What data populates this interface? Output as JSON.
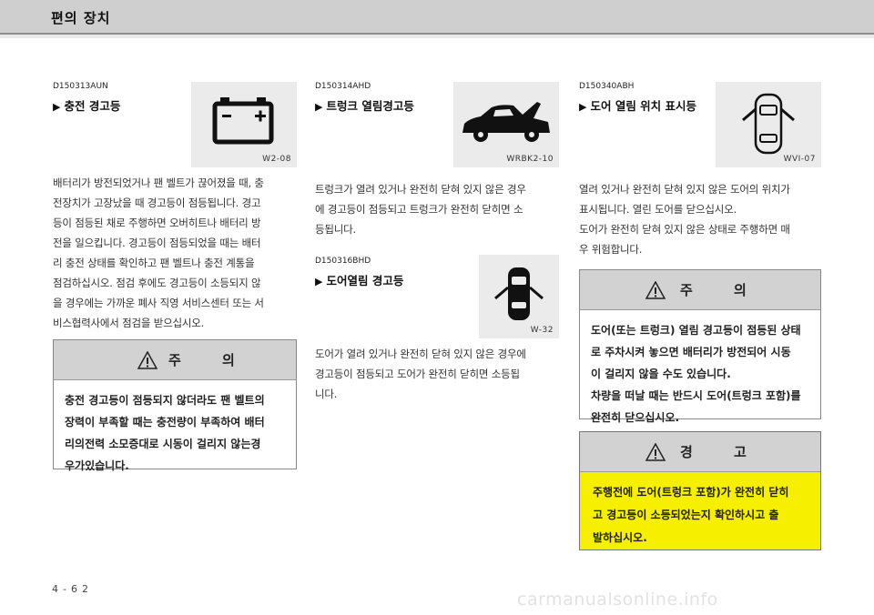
{
  "header": {
    "title": "편의 장치"
  },
  "col1": {
    "code": "D150313AUN",
    "heading": "충전 경고등",
    "icon_name": "battery-icon",
    "icon_code": "W2-08",
    "lines": [
      "배터리가 방전되었거나 팬 벨트가 끊어졌을 때, 충",
      "전장치가 고장났을 때 경고등이 점등됩니다. 경고",
      "등이 점등된 채로 주행하면 오버히트나 배터리 방",
      "전을 일으킵니다. 경고등이 점등되었을 때는 배터",
      "리 충전 상태를 확인하고 팬 벨트나 충전 계통을",
      "점검하십시오. 점검 후에도 경고등이 소등되지 않",
      "을 경우에는 가까운 폐사 직영 서비스센터 또는 서",
      "비스협력사에서 점검을 받으십시오."
    ],
    "caution": {
      "title": "주 의",
      "lines": [
        "충전 경고등이 점등되지 않더라도 팬 벨트의",
        "장력이 부족할 때는 충전량이 부족하여 배터",
        "리의전력 소모증대로 시동이 걸리지 않는경",
        "우가있습니다."
      ]
    }
  },
  "col2": {
    "code": "D150314AHD",
    "heading": "트렁크 열림경고등",
    "icon_name": "trunk-open-icon",
    "icon_code": "WRBK2-10",
    "lines": [
      "트렁크가 열려 있거나 완전히 닫혀 있지 않은 경우",
      "에 경고등이 점등되고 트렁크가 완전히 닫히면 소",
      "등됩니다."
    ],
    "code2": "D150316BHD",
    "heading2": "도어열림 경고등",
    "icon2_name": "door-open-icon",
    "icon2_code": "W-32",
    "lines2": [
      "도어가 열려 있거나 완전히 닫혀 있지 않은 경우에",
      "경고등이 점등되고 도어가 완전히 닫히면 소등됩",
      "니다."
    ]
  },
  "col3": {
    "code": "D150340ABH",
    "heading": "도어 열림 위치 표시등",
    "icon_name": "door-position-icon",
    "icon_code": "WVI-07",
    "lines": [
      "열려 있거나 완전히 닫혀 있지 않은 도어의 위치가",
      "표시됩니다. 열린 도어를 닫으십시오.",
      "도어가 완전히 닫혀 있지 않은 상태로 주행하면 매",
      "우 위험합니다."
    ],
    "caution": {
      "title": "주 의",
      "lines": [
        "도어(또는 트렁크) 열림 경고등이 점등된 상태",
        "로 주차시켜 놓으면 배터리가 방전되어 시동",
        "이 걸리지 않을 수도 있습니다.",
        "차량을 떠날 때는 반드시 도어(트렁크 포함)를",
        "완전히 닫으십시오."
      ]
    },
    "warning": {
      "title": "경 고",
      "lines": [
        "주행전에 도어(트렁크 포함)가 완전히 닫히",
        "고 경고등이 소등되었는지 확인하시고 출",
        "발하십시오."
      ]
    }
  },
  "footer": {
    "page": "4-62",
    "watermark": "carmanualsonline.info"
  },
  "colors": {
    "header_bg": "#cfcfcf",
    "warning_bg": "#f7ef00",
    "icon_bg": "#ebebeb"
  }
}
